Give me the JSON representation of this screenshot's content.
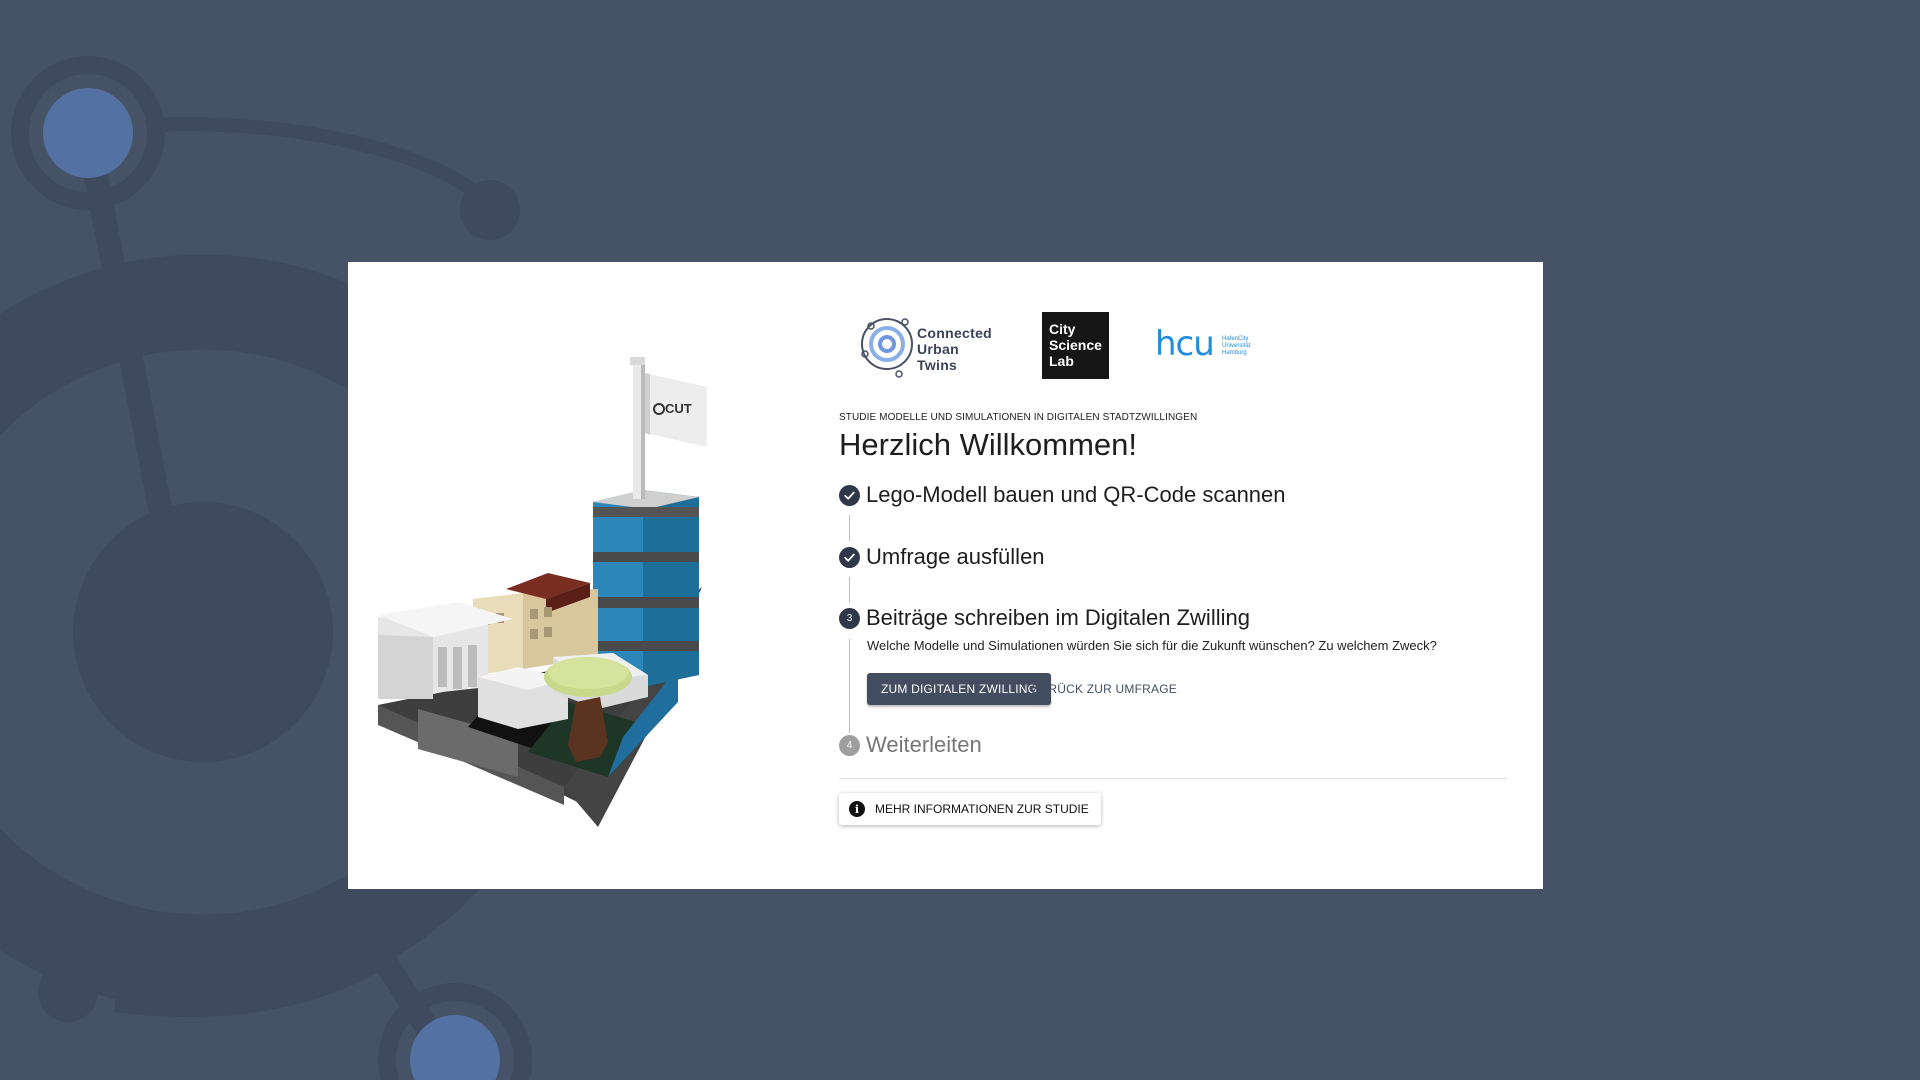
{
  "logos": {
    "cut": [
      "Connected",
      "Urban",
      "Twins"
    ],
    "csl": [
      "City",
      "Science",
      "Lab"
    ],
    "hcu_word": "hcu",
    "hcu_sub": [
      "HafenCity",
      "Universität",
      "Hamburg"
    ]
  },
  "flag_label": "CUT",
  "overline": "STUDIE MODELLE UND SIMULATIONEN IN DIGITALEN STADTZWILLINGEN",
  "title": "Herzlich Willkommen!",
  "steps": [
    {
      "label": "Lego-Modell bauen und QR-Code scannen",
      "state": "completed",
      "icon": "check-icon"
    },
    {
      "label": "Umfrage ausfüllen",
      "state": "completed",
      "icon": "check-icon"
    },
    {
      "number": "3",
      "label": "Beiträge schreiben im Digitalen Zwilling",
      "state": "active",
      "description": "Welche Modelle und Simulationen würden Sie sich für die Zukunft wünschen? Zu welchem Zweck?"
    },
    {
      "number": "4",
      "label": "Weiterleiten",
      "state": "inactive"
    }
  ],
  "buttons": {
    "primary": "ZUM DIGITALEN ZWILLING",
    "back": "ZURÜCK ZUR UMFRAGE",
    "info": "MEHR INFORMATIONEN ZUR STUDIE"
  },
  "colors": {
    "background": "#465266",
    "accent": "#434d60",
    "card": "#ffffff"
  }
}
